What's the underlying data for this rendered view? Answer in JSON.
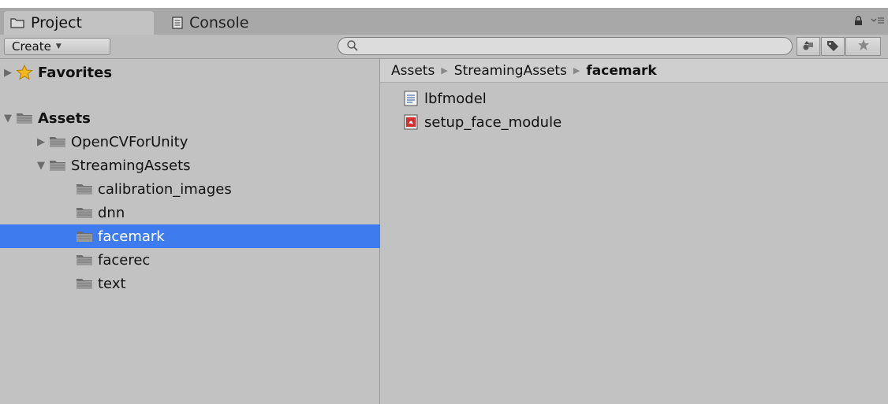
{
  "tabs": [
    {
      "label": "Project",
      "icon": "folder-icon",
      "active": true
    },
    {
      "label": "Console",
      "icon": "console-icon",
      "active": false
    }
  ],
  "toolbar": {
    "create_label": "Create",
    "search_value": "",
    "buttons": [
      "filter-by-type-icon",
      "filter-by-label-icon",
      "favorite-star-icon"
    ]
  },
  "tree": {
    "favorites": {
      "label": "Favorites",
      "expanded": false
    },
    "assets": {
      "label": "Assets",
      "expanded": true
    },
    "opencv": {
      "label": "OpenCVForUnity",
      "expanded": false
    },
    "streaming": {
      "label": "StreamingAssets",
      "expanded": true
    },
    "calibration": {
      "label": "calibration_images"
    },
    "dnn": {
      "label": "dnn"
    },
    "facemark": {
      "label": "facemark",
      "selected": true
    },
    "facerec": {
      "label": "facerec"
    },
    "text": {
      "label": "text"
    }
  },
  "breadcrumb": [
    "Assets",
    "StreamingAssets",
    "facemark"
  ],
  "files": [
    {
      "label": "lbfmodel",
      "icon": "text-document-icon"
    },
    {
      "label": "setup_face_module",
      "icon": "pdf-document-icon"
    }
  ],
  "colors": {
    "selection": "#3d7bef",
    "panel": "#c2c2c2",
    "tabbar": "#a8a8a8"
  }
}
